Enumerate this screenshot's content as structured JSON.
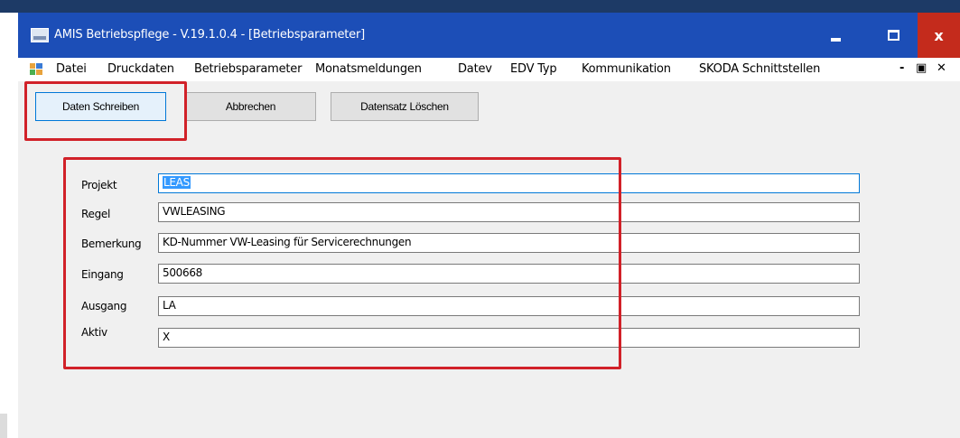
{
  "window": {
    "title": "AMIS Betriebspflege - V.19.1.0.4 - [Betriebsparameter]",
    "accent_color": "#1c4eb7",
    "close_color": "#c42b1c"
  },
  "menu": {
    "items": [
      "Datei",
      "Druckdaten",
      "Betriebsparameter",
      "Monatsmeldungen",
      "Datev",
      "EDV Typ",
      "Kommunikation",
      "SKODA Schnittstellen"
    ]
  },
  "toolbar": {
    "write_label": "Daten Schreiben",
    "cancel_label": "Abbrechen",
    "delete_label": "Datensatz Löschen"
  },
  "form": {
    "fields": [
      {
        "label": "Projekt",
        "value": "LEAS"
      },
      {
        "label": "Regel",
        "value": "VWLEASING"
      },
      {
        "label": "Bemerkung",
        "value": "KD-Nummer VW-Leasing für Servicerechnungen"
      },
      {
        "label": "Eingang",
        "value": "500668"
      },
      {
        "label": "Ausgang",
        "value": "LA"
      },
      {
        "label": "Aktiv",
        "value": "X"
      }
    ]
  },
  "annotation_color": "#d12128"
}
